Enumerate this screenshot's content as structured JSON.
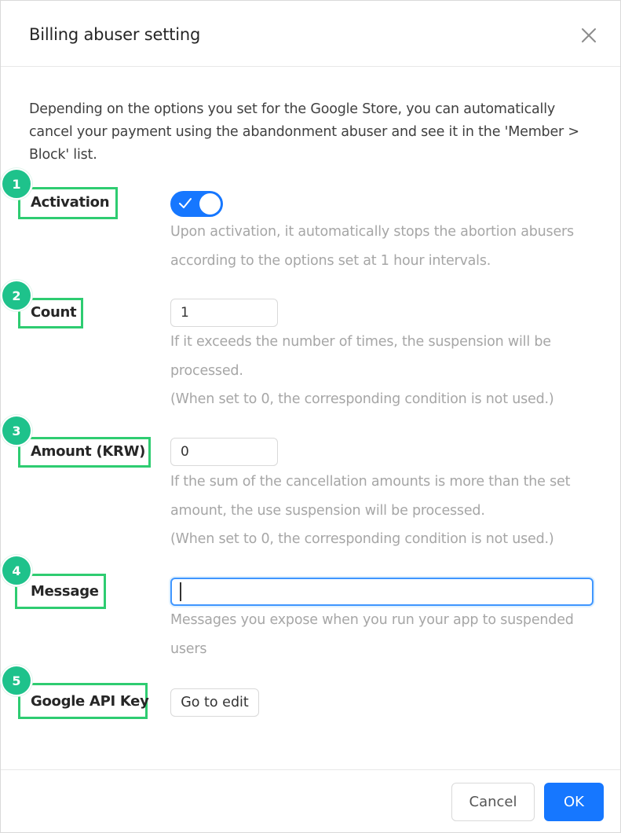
{
  "dialog": {
    "title": "Billing abuser setting",
    "close_icon": "close-icon",
    "description": "Depending on the options you set for the Google Store, you can automatically cancel your payment using the abandonment abuser and see it in the 'Member > Block' list."
  },
  "fields": {
    "activation": {
      "badge": "1",
      "label": "Activation",
      "enabled": true,
      "hint": "Upon activation, it automatically stops the abortion abusers according to the options set at 1 hour intervals."
    },
    "count": {
      "badge": "2",
      "label": "Count",
      "value": "1",
      "hint": "If it exceeds the number of times, the suspension will be processed.",
      "note": "(When set to 0, the corresponding condition is not used.)"
    },
    "amount": {
      "badge": "3",
      "label": "Amount (KRW)",
      "value": "0",
      "hint": "If the sum of the cancellation amounts is more than the set amount, the use suspension will be processed.",
      "note": "(When set to 0, the corresponding condition is not used.)"
    },
    "message": {
      "badge": "4",
      "label": "Message",
      "value": "",
      "hint": "Messages you expose when you run your app to suspended users"
    },
    "google_api_key": {
      "badge": "5",
      "label": "Google API Key",
      "button_label": "Go to edit"
    }
  },
  "footer": {
    "cancel_label": "Cancel",
    "ok_label": "OK"
  },
  "colors": {
    "primary": "#1677ff",
    "highlight_box": "#2ecc71",
    "badge": "#1ec28b",
    "hint_text": "#a6a6a6"
  }
}
